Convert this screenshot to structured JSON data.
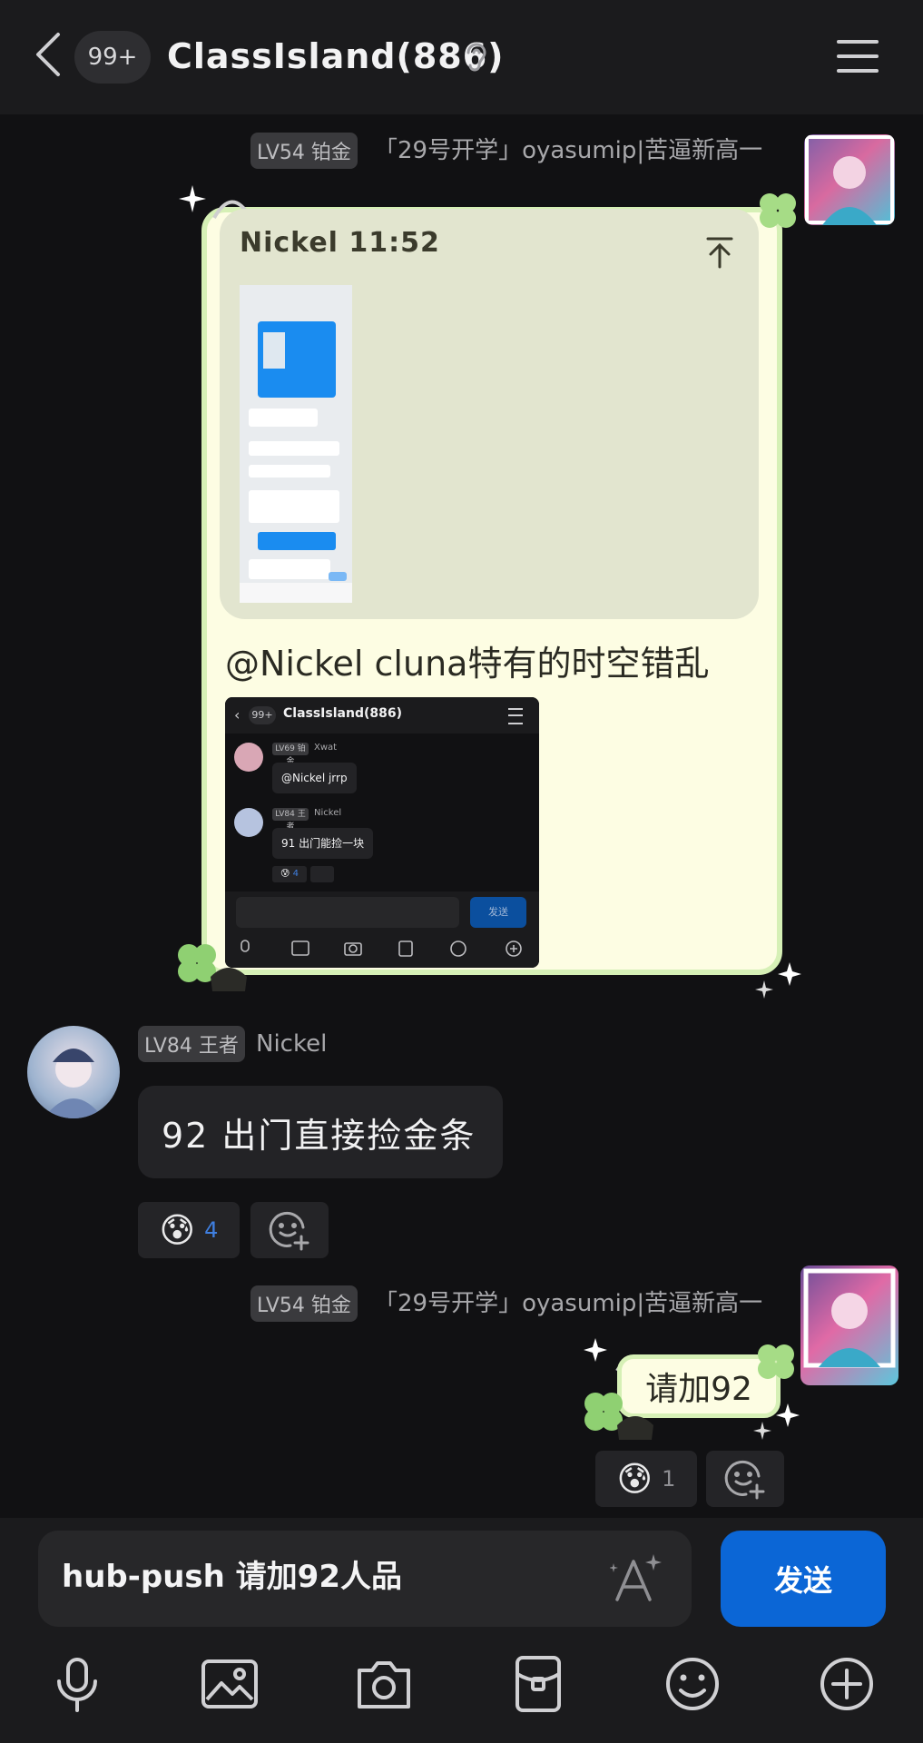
{
  "header": {
    "unread_badge": "99+",
    "chat_title": "ClassIsland(886)",
    "icons": [
      "back-arrow-icon",
      "ear-icon",
      "menu-icon"
    ]
  },
  "messages": [
    {
      "level": "LV54 铂金",
      "sender": "「29号开学」oyasumip|苦逼新高一",
      "quote_header": "Nickel 11:52",
      "text": "@Nickel cluna特有的时空错乱",
      "embedded_screenshot": {
        "badge": "99+",
        "title": "ClassIsland(886)",
        "rows": [
          {
            "level": "LV69 铂金",
            "name": "Xwat",
            "text": "@Nickel jrrp"
          },
          {
            "level": "LV84 王者",
            "name": "Nickel",
            "text": "91 出门能捡一块"
          }
        ],
        "reaction_count": "4",
        "send_label": "发送"
      }
    },
    {
      "level": "LV84 王者",
      "sender": "Nickel",
      "text": "92 出门直接捡金条",
      "reactions": [
        {
          "emoji": "😰",
          "count": "4"
        }
      ]
    },
    {
      "level": "LV54 铂金",
      "sender": "「29号开学」oyasumip|苦逼新高一",
      "text": "请加92",
      "reactions": [
        {
          "emoji": "😰",
          "count": "1"
        }
      ]
    }
  ],
  "composer": {
    "input_value": "hub-push 请加92人品",
    "send_label": "发送",
    "toolbar_icons": [
      "microphone-icon",
      "image-icon",
      "camera-icon",
      "red-packet-icon",
      "emoji-icon",
      "plus-icon"
    ]
  },
  "colors": {
    "background": "#111113",
    "bar": "#1b1b1d",
    "accent": "#0b66d6",
    "bubble_sticker": "#fdfde3",
    "reaction_count": "#3f7fe0"
  }
}
